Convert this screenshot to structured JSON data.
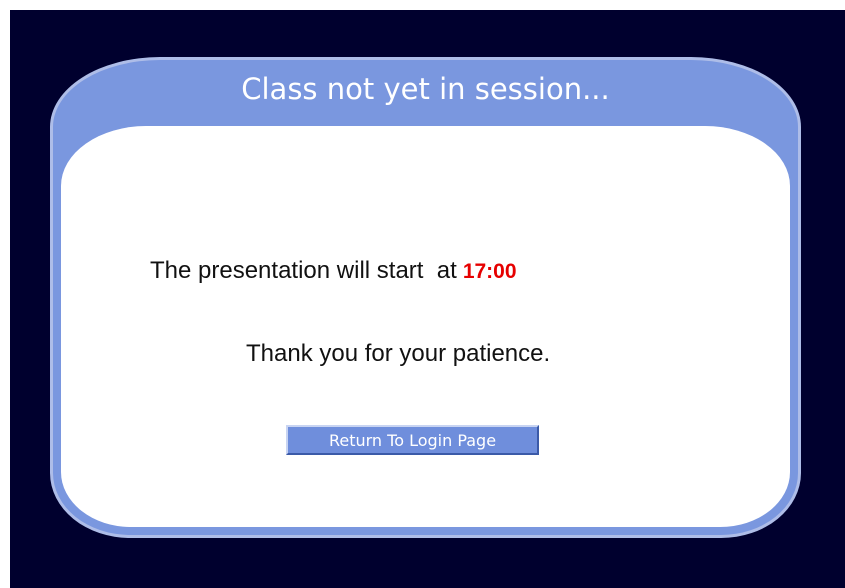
{
  "dialog": {
    "title": "Class not yet in session...",
    "message_prefix": "The presentation will start  at",
    "start_time": "17:00",
    "thanks": "Thank you for your patience.",
    "return_button_label": "Return To Login Page"
  },
  "colors": {
    "background": "#00002e",
    "card_header": "#7a97df",
    "card_body": "#ffffff",
    "time_highlight": "#e60000",
    "button": "#6f8edc"
  }
}
